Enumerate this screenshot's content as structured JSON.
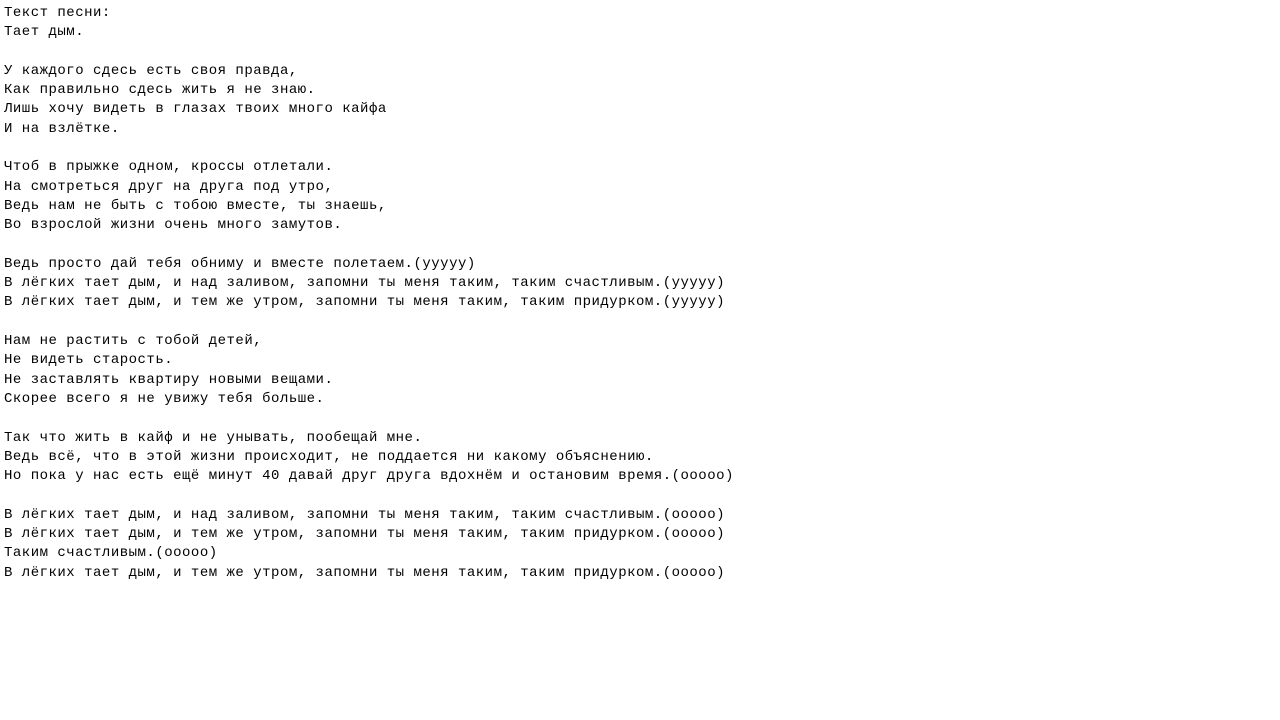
{
  "header": "Текст песни:",
  "title": "Тает дым.",
  "stanzas": [
    [
      "У каждого сдесь есть своя правда,",
      "Как правильно сдесь жить я не знаю.",
      "Лишь хочу видеть в глазах твоих много кайфа",
      "И на взлётке."
    ],
    [
      "Чтоб в прыжке одном, кроссы отлетали.",
      "На смотреться друг на друга под утро,",
      "Ведь нам не быть с тобою вместе, ты знаешь,",
      "Во взрослой жизни очень много замутов."
    ],
    [
      "Ведь просто дай тебя обниму и вместе полетаем.(ууууу)",
      "В лёгких тает дым, и над заливом, запомни ты меня таким, таким счастливым.(ууууу)",
      "В лёгких тает дым, и тем же утром, запомни ты меня таким, таким придурком.(ууууу)"
    ],
    [
      "Нам не растить с тобой детей,",
      "Не видеть старость.",
      "Не заставлять квартиру новыми вещами.",
      "Скорее всего я не увижу тебя больше."
    ],
    [
      "Так что жить в кайф и не унывать, пообещай мне.",
      "Ведь всё, что в этой жизни происходит, не поддается ни какому объяснению.",
      "Но пока у нас есть ещё минут 40 давай друг друга вдохнём и остановим время.(ооооо)"
    ],
    [
      "В лёгких тает дым, и над заливом, запомни ты меня таким, таким счастливым.(ооооо)",
      "В лёгких тает дым, и тем же утром, запомни ты меня таким, таким придурком.(ооооо)",
      "Таким счастливым.(ооооо)",
      "В лёгких тает дым, и тем же утром, запомни ты меня таким, таким придурком.(ооооо)"
    ]
  ]
}
